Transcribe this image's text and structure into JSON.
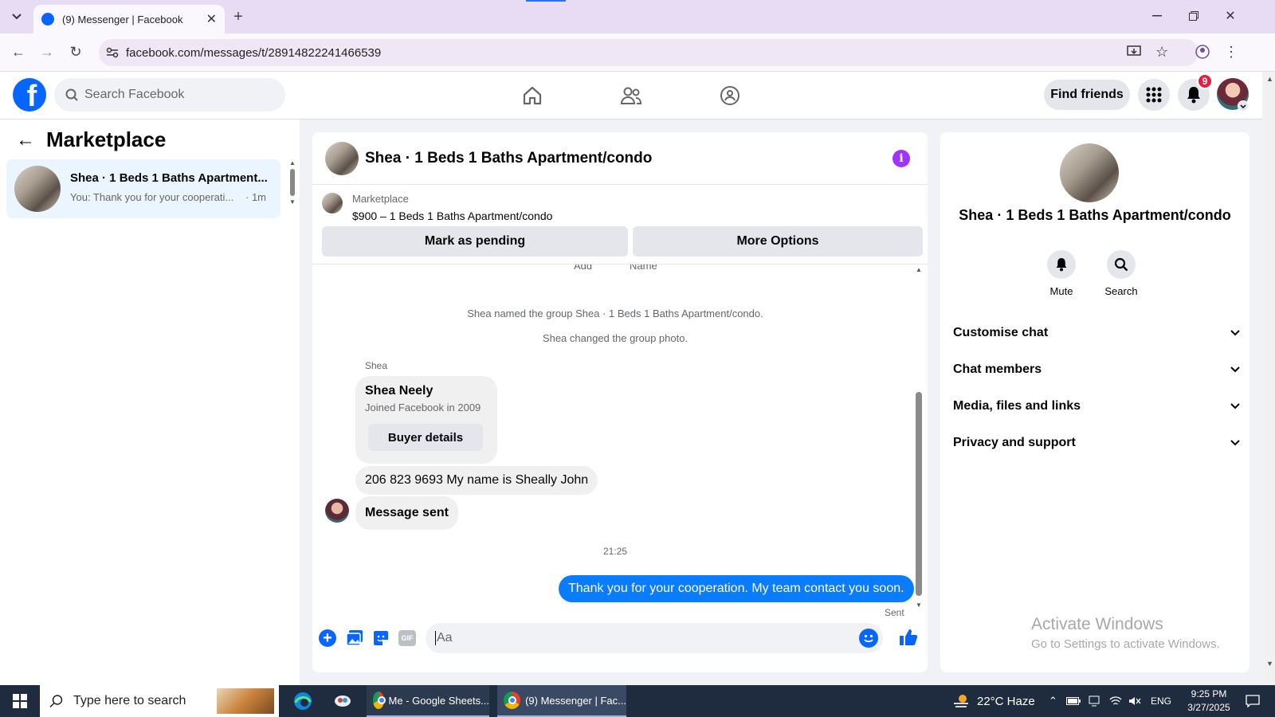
{
  "browser": {
    "tab_title": "(9) Messenger | Facebook",
    "url": "facebook.com/messages/t/28914822241466539"
  },
  "header": {
    "search_placeholder": "Search Facebook",
    "find_friends": "Find friends",
    "notification_count": "9"
  },
  "sidebar": {
    "title": "Marketplace",
    "chat": {
      "name": "Shea · 1 Beds 1 Baths Apartment...",
      "preview": "You: Thank you for your cooperati...",
      "time": "· 1m"
    }
  },
  "chat": {
    "title": "Shea · 1 Beds 1 Baths Apartment/condo",
    "listing_source": "Marketplace",
    "listing_detail": "$900 – 1 Beds 1 Baths Apartment/condo",
    "mark_pending": "Mark as pending",
    "more_options": "More Options",
    "cut_labels": [
      "Add",
      "Name"
    ],
    "system_messages": [
      "Shea named the group Shea · 1 Beds 1 Baths Apartment/condo.",
      "Shea changed the group photo."
    ],
    "sender_label": "Shea",
    "profile_card": {
      "name": "Shea Neely",
      "joined": "Joined Facebook in 2009",
      "button": "Buyer details"
    },
    "incoming_message": "206 823 9693 My name is Sheally John",
    "message_sent_label": "Message sent",
    "timestamp": "21:25",
    "outgoing_message": "Thank you for your cooperation. My team contact you soon.",
    "status": "Sent",
    "composer_placeholder": "Aa",
    "gif_label": "GIF"
  },
  "details": {
    "name": "Shea · 1 Beds 1 Baths Apartment/condo",
    "mute": "Mute",
    "search": "Search",
    "sections": [
      "Customise chat",
      "Chat members",
      "Media, files and links",
      "Privacy and support"
    ],
    "watermark_title": "Activate Windows",
    "watermark_sub": "Go to Settings to activate Windows."
  },
  "taskbar": {
    "search_placeholder": "Type here to search",
    "apps": [
      "Me - Google Sheets...",
      "(9) Messenger | Fac..."
    ],
    "weather": "22°C  Haze",
    "lang": "ENG",
    "time": "9:25 PM",
    "date": "3/27/2025"
  },
  "colors": {
    "fb_blue": "#0866ff",
    "bubble_out": "#0a7cff",
    "purple": "#a033ff"
  }
}
